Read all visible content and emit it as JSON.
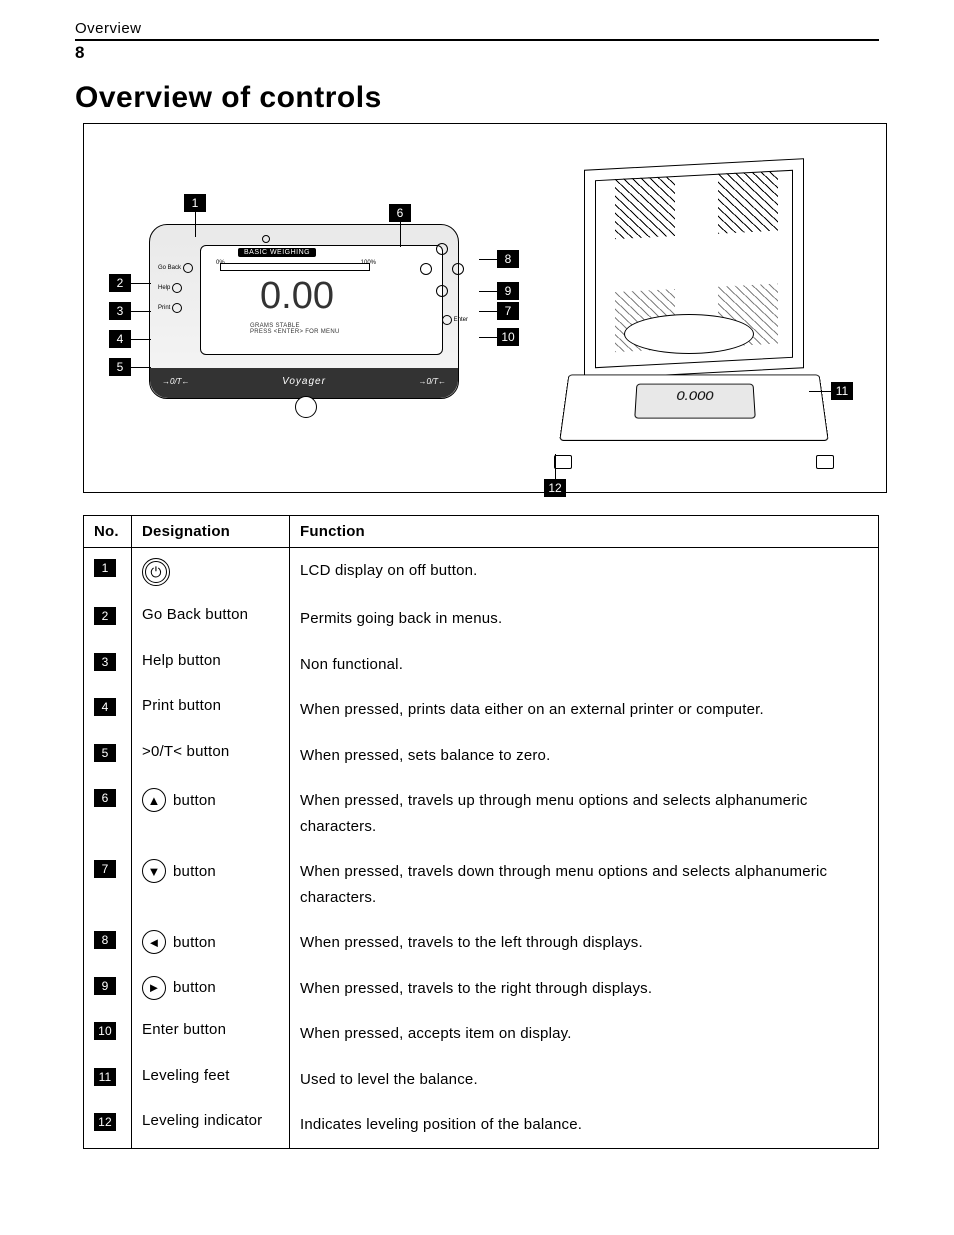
{
  "header": {
    "section": "Overview",
    "page_number": "8"
  },
  "title": "Overview of controls",
  "diagram": {
    "panel": {
      "screen_title": "BASIC WEIGHING",
      "bar_left": "0%",
      "bar_right": "100%",
      "reading": "0.00",
      "sub1": "GRAMS       STABLE",
      "sub2": "PRESS  <ENTER>  FOR MENU",
      "side_buttons": {
        "go_back": "Go Back",
        "help": "Help",
        "print": "Print"
      },
      "enter_label": "Enter",
      "footer_left": "→0/T←",
      "footer_brand": "Voyager",
      "footer_right": "→0/T←"
    },
    "unit": {
      "reading": "0.000"
    },
    "callouts": {
      "c1": "1",
      "c2": "2",
      "c3": "3",
      "c4": "4",
      "c5": "5",
      "c6": "6",
      "c7": "7",
      "c8": "8",
      "c9": "9",
      "c10": "10",
      "c11": "11",
      "c12": "12"
    }
  },
  "table": {
    "headers": {
      "no": "No.",
      "designation": "Designation",
      "function": "Function"
    },
    "rows": [
      {
        "no": "1",
        "icon": "power",
        "designation_text": "",
        "function": "LCD display on off button."
      },
      {
        "no": "2",
        "icon": null,
        "designation_text": "Go Back button",
        "function": "Permits going back in menus."
      },
      {
        "no": "3",
        "icon": null,
        "designation_text": "Help button",
        "function": "Non functional."
      },
      {
        "no": "4",
        "icon": null,
        "designation_text": "Print button",
        "function": "When pressed, prints data either on an external printer or computer."
      },
      {
        "no": "5",
        "icon": null,
        "designation_text": ">0/T< button",
        "function": "When pressed, sets balance to zero."
      },
      {
        "no": "6",
        "icon": "up",
        "designation_text": "button",
        "function": "When pressed, travels up through menu options and selects alphanumeric characters."
      },
      {
        "no": "7",
        "icon": "down",
        "designation_text": "button",
        "function": "When pressed, travels down through menu options and selects alphanumeric characters."
      },
      {
        "no": "8",
        "icon": "left",
        "designation_text": "button",
        "function": "When pressed, travels to the left through displays."
      },
      {
        "no": "9",
        "icon": "right",
        "designation_text": "button",
        "function": "When pressed, travels to the right through displays."
      },
      {
        "no": "10",
        "icon": null,
        "designation_text": "Enter button",
        "function": "When pressed, accepts item on display."
      },
      {
        "no": "11",
        "icon": null,
        "designation_text": "Leveling feet",
        "function": "Used to level the balance."
      },
      {
        "no": "12",
        "icon": null,
        "designation_text": "Leveling indicator",
        "function": "Indicates leveling position of the balance."
      }
    ]
  }
}
